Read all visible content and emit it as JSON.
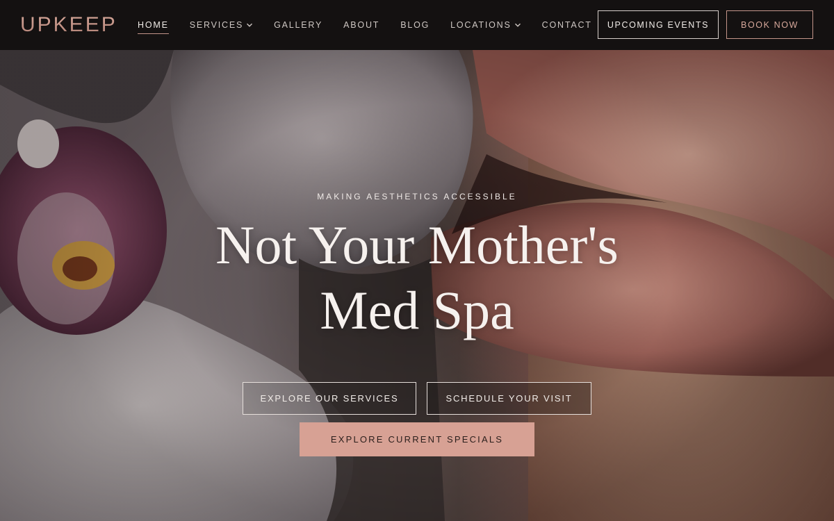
{
  "brand": {
    "logo_text": "UPKEEP",
    "accent_color": "#c4958a"
  },
  "nav": {
    "items": [
      {
        "label": "HOME",
        "active": true,
        "has_dropdown": false
      },
      {
        "label": "SERVICES",
        "active": false,
        "has_dropdown": true
      },
      {
        "label": "GALLERY",
        "active": false,
        "has_dropdown": false
      },
      {
        "label": "ABOUT",
        "active": false,
        "has_dropdown": false
      },
      {
        "label": "BLOG",
        "active": false,
        "has_dropdown": false
      },
      {
        "label": "LOCATIONS",
        "active": false,
        "has_dropdown": true
      },
      {
        "label": "CONTACT",
        "active": false,
        "has_dropdown": false
      }
    ],
    "events_button": "UPCOMING EVENTS",
    "book_button": "BOOK NOW"
  },
  "hero": {
    "eyebrow": "MAKING AESTHETICS ACCESSIBLE",
    "headline_line1": "Not Your Mother's",
    "headline_line2": "Med Spa",
    "primary_buttons": {
      "services": "EXPLORE OUR SERVICES",
      "schedule": "SCHEDULE YOUR VISIT"
    },
    "specials_button": "EXPLORE CURRENT SPECIALS",
    "specials_color": "#d7a194"
  }
}
